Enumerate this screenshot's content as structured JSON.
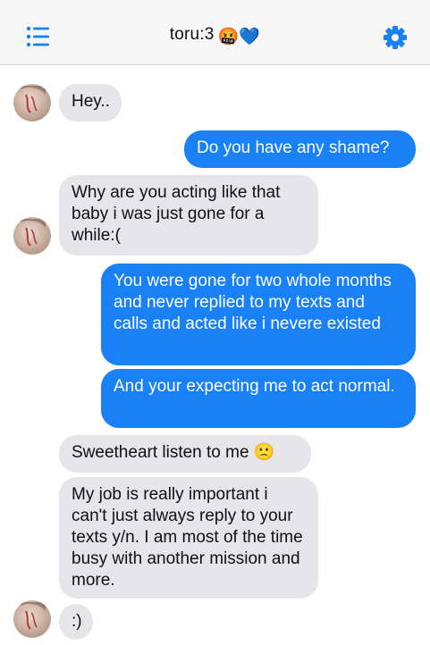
{
  "header": {
    "title": "toru:3",
    "title_emoji": "🤬💙",
    "menu_icon": "list-icon",
    "settings_icon": "gear-icon"
  },
  "messages": [
    {
      "side": "incoming",
      "text": "Hey.."
    },
    {
      "side": "outgoing",
      "text": "Do you have any shame?"
    },
    {
      "side": "incoming",
      "text": "Why are you acting like that baby i was just gone for a while:("
    },
    {
      "side": "outgoing",
      "text": "You were gone for two whole months and never replied to my texts and calls and acted like i nevere existed"
    },
    {
      "side": "outgoing",
      "text": "And your expecting me to act normal."
    },
    {
      "side": "incoming",
      "text": "Sweetheart listen to me 🙁"
    },
    {
      "side": "incoming",
      "text": "My job is really important i can't just always reply to your texts y/n. I am most of the time busy with another mission and more."
    },
    {
      "side": "incoming",
      "text": ":)"
    }
  ],
  "colors": {
    "accent": "#1a80f5",
    "incoming_bubble": "#e5e5ea",
    "nav_background": "#f7f7f8"
  }
}
